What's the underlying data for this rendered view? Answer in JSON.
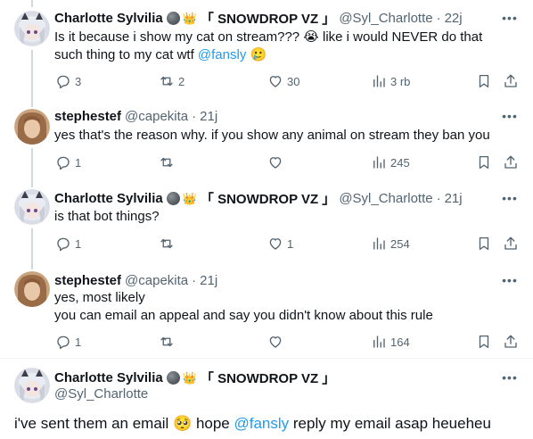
{
  "posts": [
    {
      "name": "Charlotte Sylvilia",
      "tag": "「 SNOWDROP VZ 」",
      "handle": "@Syl_Charlotte",
      "time": "22j",
      "text_before": "Is it because i show my cat on stream??? 😭 like i would NEVER do that such thing to my cat wtf ",
      "mention": "@fansly",
      "text_after": " 🥲",
      "replies": "3",
      "reposts": "2",
      "likes": "30",
      "views": "3 rb"
    },
    {
      "name": "stephestef",
      "handle": "@capekita",
      "time": "21j",
      "text": "yes that's the reason why. if you show any animal on stream they ban you",
      "replies": "1",
      "reposts": "",
      "likes": "",
      "views": "245"
    },
    {
      "name": "Charlotte Sylvilia",
      "tag": "「 SNOWDROP VZ 」",
      "handle": "@Syl_Charlotte",
      "time": "21j",
      "text": "is that bot things?",
      "replies": "1",
      "reposts": "",
      "likes": "1",
      "views": "254"
    },
    {
      "name": "stephestef",
      "handle": "@capekita",
      "time": "21j",
      "text_line1": "yes, most likely",
      "text_line2": "you can email an appeal and say you didn't know about this rule",
      "replies": "1",
      "reposts": "",
      "likes": "",
      "views": "164"
    },
    {
      "name": "Charlotte Sylvilia",
      "tag": "「 SNOWDROP VZ 」",
      "handle": "@Syl_Charlotte",
      "text_before": "i've sent them an email 🥺 hope ",
      "mention": "@fansly",
      "text_after": " reply my email asap heueheu"
    }
  ],
  "dot": "·",
  "more": "•••",
  "crown": "👑",
  "icons": {
    "reply": "reply-icon",
    "repost": "repost-icon",
    "like": "like-icon",
    "views": "views-icon",
    "bookmark": "bookmark-icon",
    "share": "share-icon",
    "more": "more-icon"
  },
  "colors": {
    "text": "#0f1419",
    "secondary": "#536471",
    "link": "#1d9bf0",
    "divider": "#eff3f4",
    "thread_line": "#cfd9de"
  }
}
